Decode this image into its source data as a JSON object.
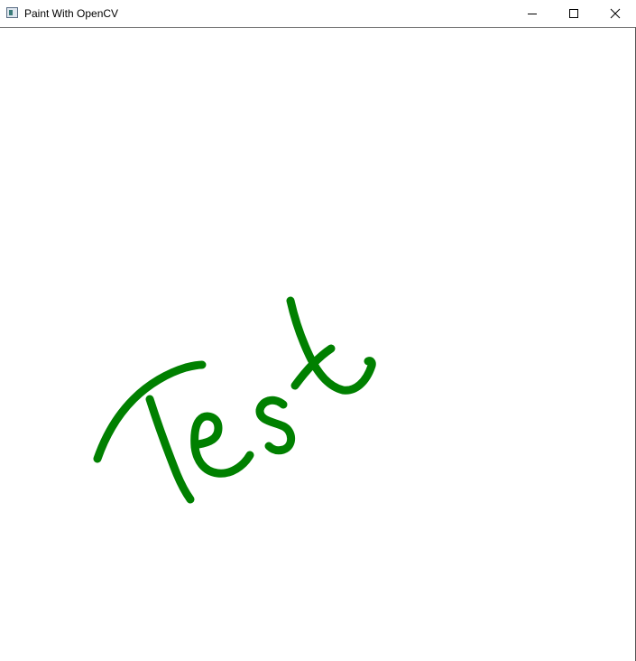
{
  "window": {
    "title": "Paint With OpenCV",
    "icon": "opencv-window-icon"
  },
  "controls": {
    "minimize_icon": "minimize-icon",
    "maximize_icon": "maximize-icon",
    "close_icon": "close-icon"
  },
  "canvas": {
    "background": "#ffffff",
    "stroke_color": "#008000",
    "drawn_text": "Test"
  }
}
